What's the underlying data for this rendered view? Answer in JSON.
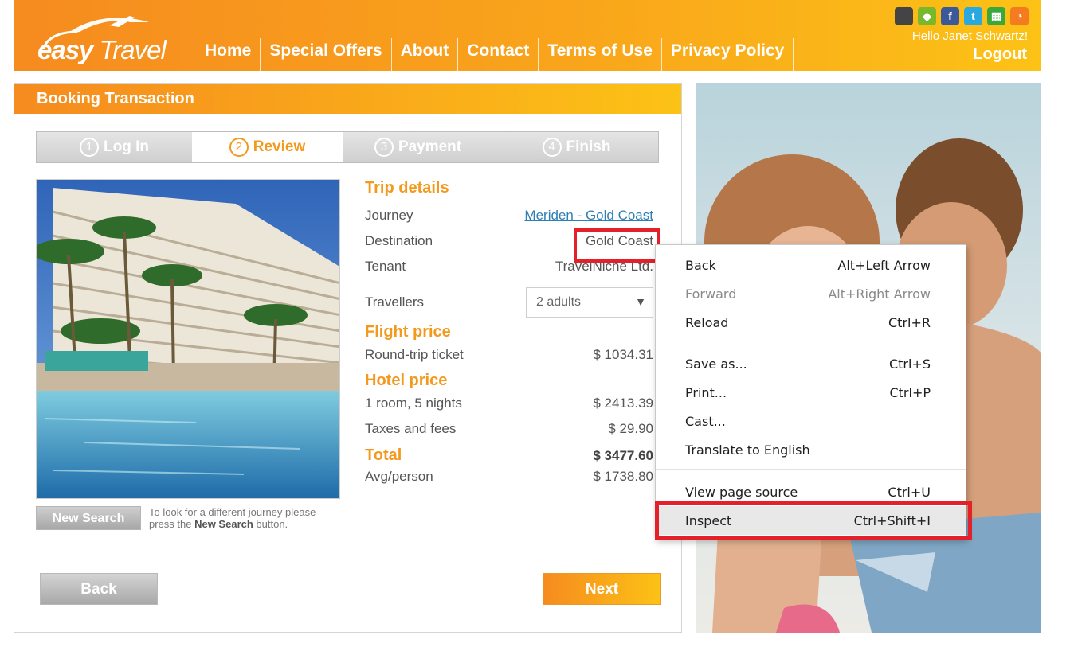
{
  "header": {
    "logo": {
      "word1": "easy",
      "word2": "Travel"
    },
    "nav": [
      "Home",
      "Special Offers",
      "About",
      "Contact",
      "Terms of Use",
      "Privacy Policy"
    ],
    "social_icons": [
      {
        "name": "apple-icon",
        "color": "#444444",
        "glyph": ""
      },
      {
        "name": "android-icon",
        "color": "#78b82a",
        "glyph": "◆"
      },
      {
        "name": "facebook-icon",
        "color": "#3b5998",
        "glyph": "f"
      },
      {
        "name": "twitter-icon",
        "color": "#2aa9e0",
        "glyph": "t"
      },
      {
        "name": "windows-icon",
        "color": "#3aa83a",
        "glyph": "▦"
      },
      {
        "name": "rss-icon",
        "color": "#f47b20",
        "glyph": "◔"
      }
    ],
    "greeting": "Hello Janet Schwartz!",
    "logout": "Logout"
  },
  "panel": {
    "title": "Booking Transaction",
    "steps": [
      {
        "num": "1",
        "label": "Log In",
        "active": false
      },
      {
        "num": "2",
        "label": "Review",
        "active": true
      },
      {
        "num": "3",
        "label": "Payment",
        "active": false
      },
      {
        "num": "4",
        "label": "Finish",
        "active": false
      }
    ],
    "trip_details_title": "Trip details",
    "journey_label": "Journey",
    "journey_value": "Meriden - Gold Coast",
    "destination_label": "Destination",
    "destination_value": "Gold Coast",
    "tenant_label": "Tenant",
    "tenant_value": "TravelNiche Ltd.",
    "travellers_label": "Travellers",
    "travellers_value": "2 adults",
    "flight_title": "Flight price",
    "roundtrip_label": "Round-trip ticket",
    "roundtrip_value": "$ 1034.31",
    "hotel_title": "Hotel price",
    "room_label": "1 room, 5 nights",
    "room_value": "$ 2413.39",
    "taxes_label": "Taxes and fees",
    "taxes_value": "$ 29.90",
    "total_label": "Total",
    "total_value": "$ 3477.60",
    "avg_label": "Avg/person",
    "avg_value": "$ 1738.80",
    "new_search_button": "New Search",
    "new_search_hint_1": "To look for a different journey please press the ",
    "new_search_hint_bold": "New Search",
    "new_search_hint_2": " button.",
    "back_button": "Back",
    "next_button": "Next"
  },
  "context_menu": [
    {
      "label": "Back",
      "shortcut": "Alt+Left Arrow",
      "disabled": false
    },
    {
      "label": "Forward",
      "shortcut": "Alt+Right Arrow",
      "disabled": true
    },
    {
      "label": "Reload",
      "shortcut": "Ctrl+R",
      "disabled": false
    },
    {
      "label": "Save as...",
      "shortcut": "Ctrl+S",
      "disabled": false
    },
    {
      "label": "Print...",
      "shortcut": "Ctrl+P",
      "disabled": false
    },
    {
      "label": "Cast...",
      "shortcut": "",
      "disabled": false
    },
    {
      "label": "Translate to English",
      "shortcut": "",
      "disabled": false
    },
    {
      "label": "View page source",
      "shortcut": "Ctrl+U",
      "disabled": false
    },
    {
      "label": "Inspect",
      "shortcut": "Ctrl+Shift+I",
      "disabled": false,
      "highlighted": true
    }
  ],
  "colors": {
    "accent": "#f39a1e",
    "highlight": "#e4202a",
    "link": "#2e7fb4"
  }
}
